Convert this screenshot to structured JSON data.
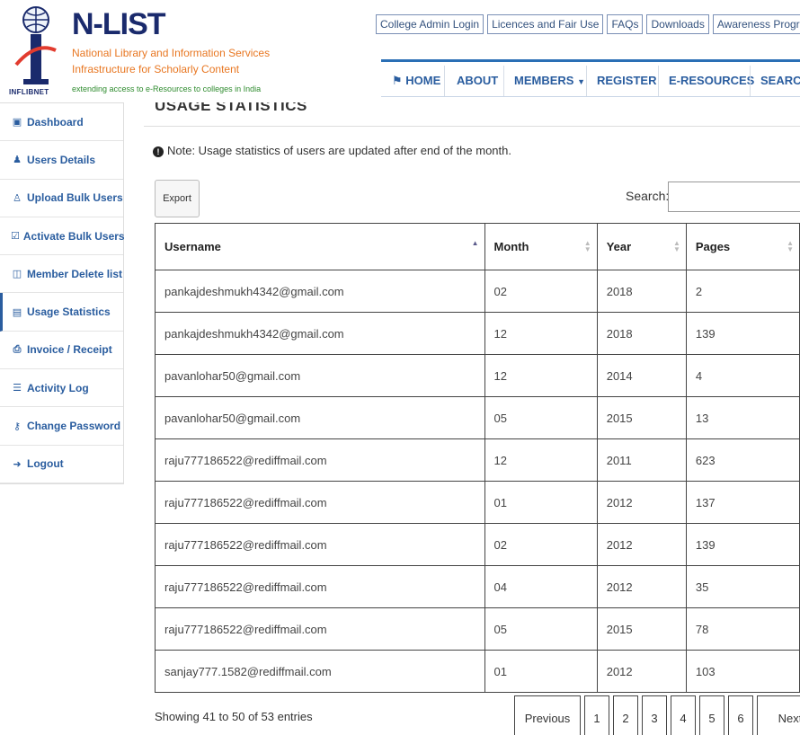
{
  "logo": {
    "title": "N-LIST",
    "line1": "National Library and Information Services",
    "line2": "Infrastructure for Scholarly Content",
    "tagline": "extending access to e-Resources to colleges in India",
    "badge": "INFLIBNET"
  },
  "top_links": [
    "College Admin Login",
    "Licences and Fair Use",
    "FAQs",
    "Downloads",
    "Awareness Programme"
  ],
  "nav": {
    "home": "HOME",
    "about": "ABOUT",
    "members": "MEMBERS",
    "register": "REGISTER",
    "eresources": "E-RESOURCES",
    "search": "SEARCH"
  },
  "sidebar": {
    "items": [
      {
        "label": "Dashboard",
        "icon": "dashboard-icon"
      },
      {
        "label": "Users Details",
        "icon": "user-icon"
      },
      {
        "label": "Upload Bulk Users",
        "icon": "users-upload-icon"
      },
      {
        "label": "Activate Bulk Users",
        "icon": "checkbox-icon"
      },
      {
        "label": "Member Delete list",
        "icon": "trash-icon"
      },
      {
        "label": "Usage Statistics",
        "icon": "bar-chart-icon"
      },
      {
        "label": "Invoice / Receipt",
        "icon": "print-icon"
      },
      {
        "label": "Activity Log",
        "icon": "list-icon"
      },
      {
        "label": "Change Password",
        "icon": "key-icon"
      },
      {
        "label": "Logout",
        "icon": "sign-out-icon"
      }
    ],
    "active_index": 5
  },
  "main": {
    "title": "USAGE STATISTICS",
    "note": "Note: Usage statistics of users are updated after end of the month.",
    "export_label": "Export",
    "search_label": "Search:",
    "search_value": ""
  },
  "table": {
    "headers": [
      "Username",
      "Month",
      "Year",
      "Pages"
    ],
    "rows": [
      [
        "pankajdeshmukh4342@gmail.com",
        "02",
        "2018",
        "2"
      ],
      [
        "pankajdeshmukh4342@gmail.com",
        "12",
        "2018",
        "139"
      ],
      [
        "pavanlohar50@gmail.com",
        "12",
        "2014",
        "4"
      ],
      [
        "pavanlohar50@gmail.com",
        "05",
        "2015",
        "13"
      ],
      [
        "raju777186522@rediffmail.com",
        "12",
        "2011",
        "623"
      ],
      [
        "raju777186522@rediffmail.com",
        "01",
        "2012",
        "137"
      ],
      [
        "raju777186522@rediffmail.com",
        "02",
        "2012",
        "139"
      ],
      [
        "raju777186522@rediffmail.com",
        "04",
        "2012",
        "35"
      ],
      [
        "raju777186522@rediffmail.com",
        "05",
        "2015",
        "78"
      ],
      [
        "sanjay777.1582@rediffmail.com",
        "01",
        "2012",
        "103"
      ]
    ]
  },
  "footer": {
    "info": "Showing 41 to 50 of 53 entries",
    "previous": "Previous",
    "pages": [
      "1",
      "2",
      "3",
      "4",
      "5",
      "6"
    ],
    "next": "Next"
  },
  "colors": {
    "brand_navy": "#1a2a6c",
    "brand_orange": "#e87722",
    "link_blue": "#2a5d9f",
    "nav_accent": "#2a6fb5"
  }
}
